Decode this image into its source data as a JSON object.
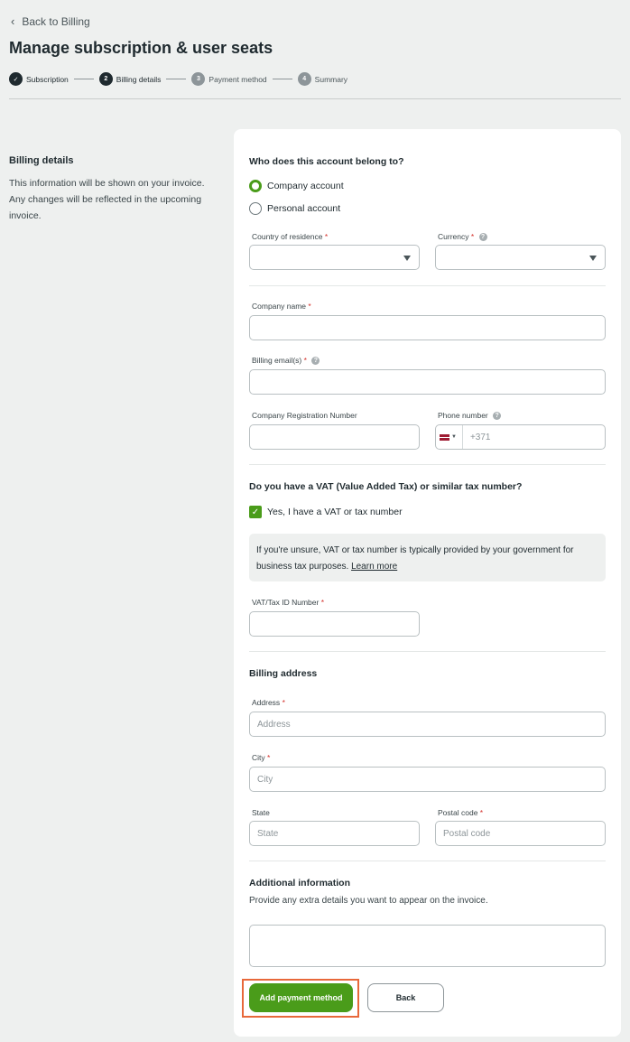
{
  "nav": {
    "back_label": "Back to Billing"
  },
  "page": {
    "title": "Manage subscription & user seats"
  },
  "stepper": [
    {
      "label": "Subscription",
      "marker": "✓",
      "state": "done"
    },
    {
      "label": "Billing details",
      "marker": "2",
      "state": "active"
    },
    {
      "label": "Payment method",
      "marker": "3",
      "state": "pending"
    },
    {
      "label": "Summary",
      "marker": "4",
      "state": "pending"
    }
  ],
  "side": {
    "heading": "Billing details",
    "description": "This information will be shown on your invoice. Any changes will be reflected in the upcoming invoice."
  },
  "form": {
    "account_question": "Who does this account belong to?",
    "account_options": [
      "Company account",
      "Personal account"
    ],
    "selected_account": "Company account",
    "country_label": "Country of residence",
    "currency_label": "Currency",
    "company_name_label": "Company name",
    "billing_email_label": "Billing email(s)",
    "company_reg_label": "Company Registration Number",
    "phone_label": "Phone number",
    "phone_prefix": "+371",
    "vat_question": "Do you have a VAT (Value Added Tax) or similar tax number?",
    "vat_checkbox_label": "Yes, I have a VAT or tax number",
    "vat_checked": true,
    "vat_info_text": "If you're unsure, VAT or tax number is typically provided by your government for business tax purposes.",
    "vat_info_link": "Learn more",
    "vat_id_label": "VAT/Tax ID Number",
    "billing_address_heading": "Billing address",
    "address_label": "Address",
    "address_placeholder": "Address",
    "city_label": "City",
    "city_placeholder": "City",
    "state_label": "State",
    "state_placeholder": "State",
    "postal_label": "Postal code",
    "postal_placeholder": "Postal code",
    "additional_heading": "Additional information",
    "additional_desc": "Provide any extra details you want to appear on the invoice.",
    "required_mark": "*",
    "help_mark": "?"
  },
  "actions": {
    "primary_label": "Add payment method",
    "secondary_label": "Back"
  },
  "colors": {
    "accent": "#4a9c1a",
    "required": "#d4312b",
    "highlight": "#e8683a",
    "background": "#eef0ef"
  }
}
